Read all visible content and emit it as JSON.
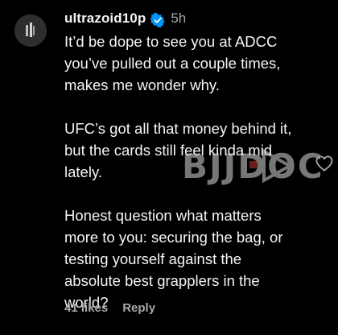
{
  "comment": {
    "username": "ultrazoid10p",
    "timestamp": "5h",
    "paragraphs": [
      "It’d be dope to see you at ADCC\nyou’ve pulled out a couple times,\nmakes me wonder why.",
      "UFC’s got all that money behind it,\nbut the cards still feel kinda mid\nlately.",
      "Honest question what matters\nmore to you: securing the bag, or\ntesting yourself against the\nabsolute best grapplers in the\nworld?"
    ],
    "likes_label": "41 likes",
    "reply_label": "Reply"
  },
  "watermark": {
    "text": "BJJDOC"
  },
  "icons": {
    "verified": "verified-badge-icon",
    "like": "heart-icon",
    "watermark_play": "play-icon"
  },
  "colors": {
    "background": "#000000",
    "text": "#f5f5f5",
    "muted": "#a8a8a8",
    "verified_blue": "#0095f6"
  }
}
